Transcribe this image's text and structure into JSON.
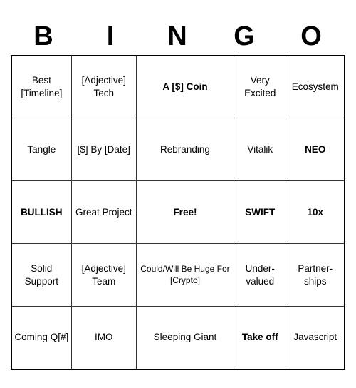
{
  "title": "BINGO",
  "header": {
    "letters": [
      "B",
      "I",
      "N",
      "G",
      "O"
    ]
  },
  "cells": [
    [
      {
        "text": "Best [Timeline]",
        "style": "normal"
      },
      {
        "text": "[Adjective] Tech",
        "style": "normal"
      },
      {
        "text": "A [$] Coin",
        "style": "large"
      },
      {
        "text": "Very Excited",
        "style": "normal"
      },
      {
        "text": "Ecosystem",
        "style": "normal"
      }
    ],
    [
      {
        "text": "Tangle",
        "style": "medium"
      },
      {
        "text": "[$] By [Date]",
        "style": "normal"
      },
      {
        "text": "Rebranding",
        "style": "normal"
      },
      {
        "text": "Vitalik",
        "style": "medium"
      },
      {
        "text": "NEO",
        "style": "large"
      }
    ],
    [
      {
        "text": "BULLISH",
        "style": "normal bold"
      },
      {
        "text": "Great Project",
        "style": "normal"
      },
      {
        "text": "Free!",
        "style": "free"
      },
      {
        "text": "SWIFT",
        "style": "normal bold"
      },
      {
        "text": "10x",
        "style": "large"
      }
    ],
    [
      {
        "text": "Solid Support",
        "style": "normal"
      },
      {
        "text": "[Adjective] Team",
        "style": "normal"
      },
      {
        "text": "Could/Will Be Huge For [Crypto]",
        "style": "small"
      },
      {
        "text": "Under-valued",
        "style": "normal"
      },
      {
        "text": "Partner-ships",
        "style": "normal"
      }
    ],
    [
      {
        "text": "Coming Q[#]",
        "style": "normal"
      },
      {
        "text": "IMO",
        "style": "medium"
      },
      {
        "text": "Sleeping Giant",
        "style": "normal"
      },
      {
        "text": "Take off",
        "style": "takeof"
      },
      {
        "text": "Javascript",
        "style": "normal"
      }
    ]
  ]
}
